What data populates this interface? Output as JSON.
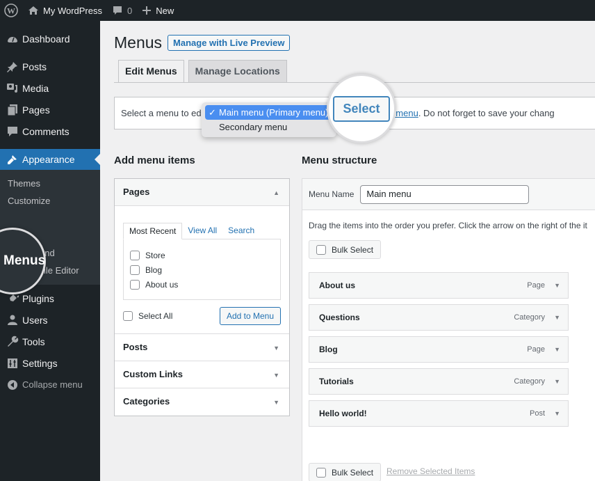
{
  "adminbar": {
    "site_name": "My WordPress",
    "comments_count": "0",
    "new_label": "New"
  },
  "sidebar": {
    "items": [
      {
        "label": "Dashboard",
        "icon": "dashboard-icon"
      },
      {
        "label": "Posts",
        "icon": "pin-icon"
      },
      {
        "label": "Media",
        "icon": "media-icon"
      },
      {
        "label": "Pages",
        "icon": "pages-icon"
      },
      {
        "label": "Comments",
        "icon": "comment-icon"
      },
      {
        "label": "Appearance",
        "icon": "brush-icon",
        "active": true
      },
      {
        "label": "Plugins",
        "icon": "plug-icon"
      },
      {
        "label": "Users",
        "icon": "user-icon"
      },
      {
        "label": "Tools",
        "icon": "wrench-icon"
      },
      {
        "label": "Settings",
        "icon": "settings-icon"
      }
    ],
    "appearance_submenu": [
      "Themes",
      "Customize",
      "",
      "Menus",
      "und",
      "Theme File Editor"
    ],
    "collapse_label": "Collapse menu",
    "magnified_label": "Menus"
  },
  "page": {
    "title": "Menus",
    "live_preview_button": "Manage with Live Preview",
    "tabs": [
      "Edit Menus",
      "Manage Locations"
    ],
    "active_tab": "Edit Menus"
  },
  "manage_bar": {
    "label": "Select a menu to edit:",
    "select_button": "Select",
    "link_text": "reate a new menu",
    "suffix": ". Do not forget to save your chang",
    "dropdown_options": [
      "Main menu (Primary menu)",
      "Secondary menu"
    ],
    "selected_option": "Main menu (Primary menu)"
  },
  "add_items": {
    "heading": "Add menu items",
    "pages": {
      "title": "Pages",
      "tabs": [
        "Most Recent",
        "View All",
        "Search"
      ],
      "items": [
        "Store",
        "Blog",
        "About us"
      ],
      "select_all": "Select All",
      "add_button": "Add to Menu"
    },
    "sections": [
      "Posts",
      "Custom Links",
      "Categories"
    ]
  },
  "menu_structure": {
    "heading": "Menu structure",
    "name_label": "Menu Name",
    "name_value": "Main menu",
    "description": "Drag the items into the order you prefer. Click the arrow on the right of the it",
    "bulk_select": "Bulk Select",
    "remove_selected": "Remove Selected Items",
    "items": [
      {
        "title": "About us",
        "type": "Page"
      },
      {
        "title": "Questions",
        "type": "Category"
      },
      {
        "title": "Blog",
        "type": "Page"
      },
      {
        "title": "Tutorials",
        "type": "Category"
      },
      {
        "title": "Hello world!",
        "type": "Post"
      }
    ]
  },
  "colors": {
    "accent": "#2271b1",
    "adminbar_bg": "#1d2327",
    "submenu_bg": "#2c3338",
    "page_bg": "#f0f0f1"
  }
}
